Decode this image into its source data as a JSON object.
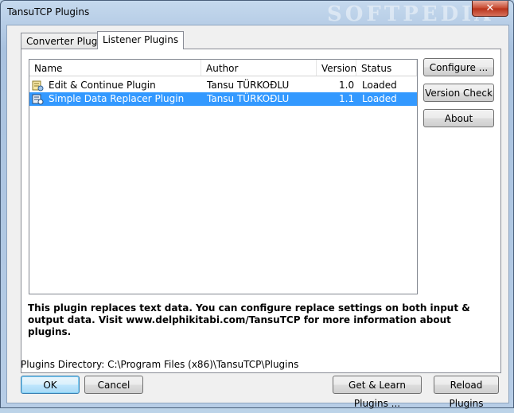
{
  "window": {
    "title": "TansuTCP Plugins",
    "close_glyph": "✕",
    "watermark": "SOFTPEDIA"
  },
  "tabs": [
    {
      "label": "Converter Plugins",
      "active": false
    },
    {
      "label": "Listener Plugins",
      "active": true
    }
  ],
  "list": {
    "columns": [
      "Name",
      "Author",
      "Version",
      "Status"
    ],
    "rows": [
      {
        "name": "Edit & Continue Plugin",
        "author": "Tansu TÜRKOĐLU",
        "version": "1.0",
        "status": "Loaded",
        "selected": false
      },
      {
        "name": "Simple Data Replacer Plugin",
        "author": "Tansu TÜRKOĐLU",
        "version": "1.1",
        "status": "Loaded",
        "selected": true
      }
    ]
  },
  "side_buttons": {
    "configure": "Configure ...",
    "version_check": "Version Check",
    "about": "About"
  },
  "description": "This plugin replaces text data. You can configure replace settings on both input & output data. Visit www.delphikitabi.com/TansuTCP for more information about plugins.",
  "plugins_directory": "Plugins Directory: C:\\Program Files (x86)\\TansuTCP\\Plugins",
  "bottom_buttons": {
    "ok": "OK",
    "cancel": "Cancel",
    "get_learn": "Get & Learn Plugins ...",
    "reload": "Reload Plugins"
  },
  "colors": {
    "selection": "#3399ff",
    "title_bar": "#b7cde6",
    "close": "#c7472d"
  },
  "icons": [
    "plugin-icon",
    "close-icon"
  ]
}
